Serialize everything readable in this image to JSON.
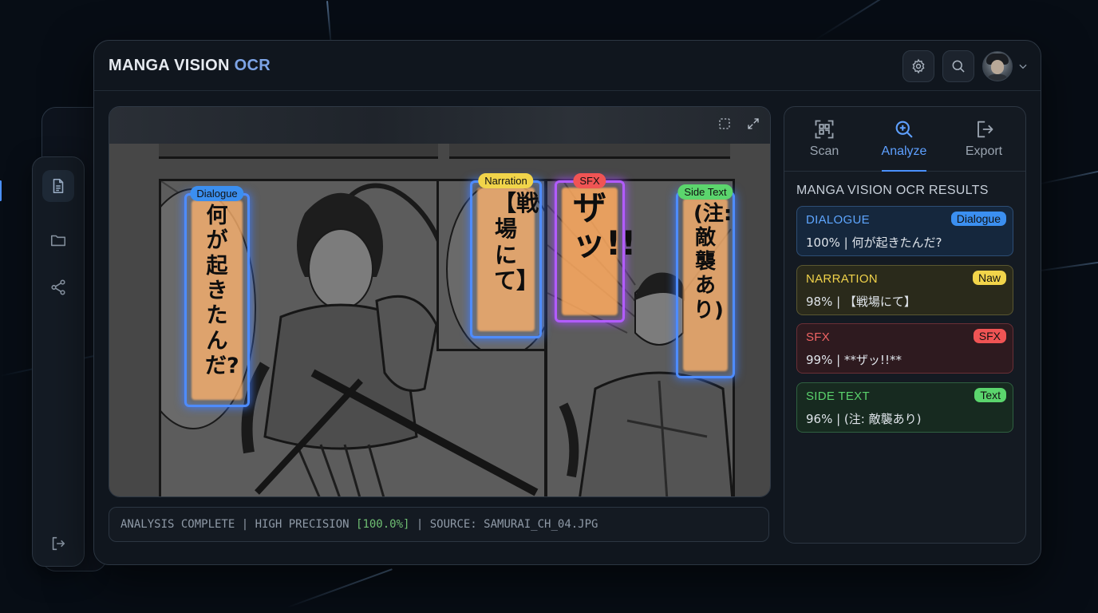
{
  "app": {
    "title_main": "MANGA VISION",
    "title_accent": "OCR"
  },
  "toolbar": {
    "settings_icon": "gear-icon",
    "search_icon": "search-icon",
    "profile_chevron_icon": "chevron-down-icon"
  },
  "rail": {
    "items": [
      {
        "icon": "document-icon",
        "active": true
      },
      {
        "icon": "folder-icon",
        "active": false
      },
      {
        "icon": "share-icon",
        "active": false
      }
    ],
    "logout_icon": "logout-icon"
  },
  "viewer": {
    "tools": [
      "select-region-icon",
      "fullscreen-icon"
    ],
    "ocr_regions": [
      {
        "tag": "Dialogue",
        "text": "何が起きたんだ?",
        "tag_color": "#3b8ff0"
      },
      {
        "tag": "Narration",
        "text": "【戦場にて】",
        "tag_color": "#f1d44a"
      },
      {
        "tag": "SFX",
        "text": "ザッ!!",
        "tag_color": "#f05454"
      },
      {
        "tag": "Side Text",
        "text": "(注:敵襲あり)",
        "tag_color": "#5bd56d"
      }
    ]
  },
  "status": {
    "prefix": "ANALYSIS COMPLETE | HIGH PRECISION ",
    "precision": "[100.0%]",
    "suffix": " | SOURCE: SAMURAI_CH_04.JPG"
  },
  "tabs": [
    {
      "label": "Scan",
      "icon": "qr-scan-icon"
    },
    {
      "label": "Analyze",
      "icon": "zoom-in-icon",
      "active": true
    },
    {
      "label": "Export",
      "icon": "export-icon"
    }
  ],
  "results": {
    "title": "MANGA VISION OCR RESULTS",
    "items": [
      {
        "title": "DIALOGUE",
        "badge": "Dialogue",
        "value": "100% | 何が起きたんだ?",
        "color": "#3b8ff0"
      },
      {
        "title": "NARRATION",
        "badge": "Naw",
        "value": "98% | 【戦場にて】",
        "color": "#f1d44a"
      },
      {
        "title": "SFX",
        "badge": "SFX",
        "value": "99% | **ザッ!!**",
        "color": "#f05454"
      },
      {
        "title": "SIDE TEXT",
        "badge": "Text",
        "value": "96% | (注: 敵襲あり)",
        "color": "#5bd56d"
      }
    ]
  }
}
